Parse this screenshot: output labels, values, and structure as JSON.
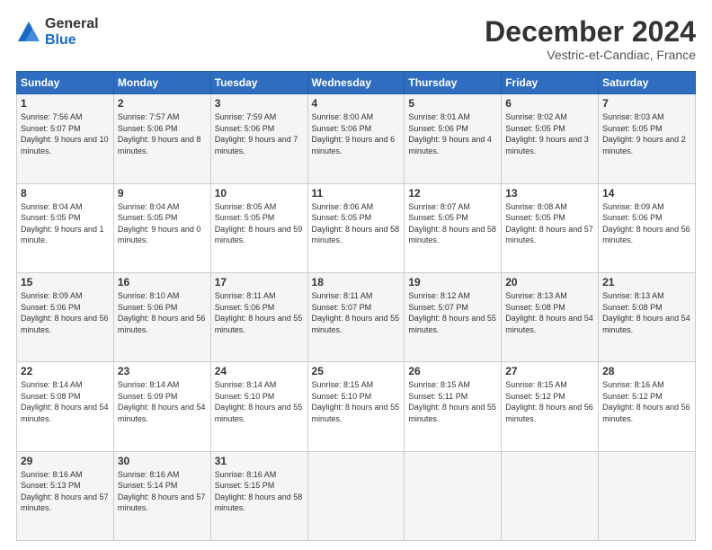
{
  "header": {
    "logo_line1": "General",
    "logo_line2": "Blue",
    "month": "December 2024",
    "location": "Vestric-et-Candiac, France"
  },
  "weekdays": [
    "Sunday",
    "Monday",
    "Tuesday",
    "Wednesday",
    "Thursday",
    "Friday",
    "Saturday"
  ],
  "weeks": [
    [
      {
        "day": "1",
        "rise": "Sunrise: 7:56 AM",
        "set": "Sunset: 5:07 PM",
        "light": "Daylight: 9 hours and 10 minutes."
      },
      {
        "day": "2",
        "rise": "Sunrise: 7:57 AM",
        "set": "Sunset: 5:06 PM",
        "light": "Daylight: 9 hours and 8 minutes."
      },
      {
        "day": "3",
        "rise": "Sunrise: 7:59 AM",
        "set": "Sunset: 5:06 PM",
        "light": "Daylight: 9 hours and 7 minutes."
      },
      {
        "day": "4",
        "rise": "Sunrise: 8:00 AM",
        "set": "Sunset: 5:06 PM",
        "light": "Daylight: 9 hours and 6 minutes."
      },
      {
        "day": "5",
        "rise": "Sunrise: 8:01 AM",
        "set": "Sunset: 5:06 PM",
        "light": "Daylight: 9 hours and 4 minutes."
      },
      {
        "day": "6",
        "rise": "Sunrise: 8:02 AM",
        "set": "Sunset: 5:05 PM",
        "light": "Daylight: 9 hours and 3 minutes."
      },
      {
        "day": "7",
        "rise": "Sunrise: 8:03 AM",
        "set": "Sunset: 5:05 PM",
        "light": "Daylight: 9 hours and 2 minutes."
      }
    ],
    [
      {
        "day": "8",
        "rise": "Sunrise: 8:04 AM",
        "set": "Sunset: 5:05 PM",
        "light": "Daylight: 9 hours and 1 minute."
      },
      {
        "day": "9",
        "rise": "Sunrise: 8:04 AM",
        "set": "Sunset: 5:05 PM",
        "light": "Daylight: 9 hours and 0 minutes."
      },
      {
        "day": "10",
        "rise": "Sunrise: 8:05 AM",
        "set": "Sunset: 5:05 PM",
        "light": "Daylight: 8 hours and 59 minutes."
      },
      {
        "day": "11",
        "rise": "Sunrise: 8:06 AM",
        "set": "Sunset: 5:05 PM",
        "light": "Daylight: 8 hours and 58 minutes."
      },
      {
        "day": "12",
        "rise": "Sunrise: 8:07 AM",
        "set": "Sunset: 5:05 PM",
        "light": "Daylight: 8 hours and 58 minutes."
      },
      {
        "day": "13",
        "rise": "Sunrise: 8:08 AM",
        "set": "Sunset: 5:05 PM",
        "light": "Daylight: 8 hours and 57 minutes."
      },
      {
        "day": "14",
        "rise": "Sunrise: 8:09 AM",
        "set": "Sunset: 5:06 PM",
        "light": "Daylight: 8 hours and 56 minutes."
      }
    ],
    [
      {
        "day": "15",
        "rise": "Sunrise: 8:09 AM",
        "set": "Sunset: 5:06 PM",
        "light": "Daylight: 8 hours and 56 minutes."
      },
      {
        "day": "16",
        "rise": "Sunrise: 8:10 AM",
        "set": "Sunset: 5:06 PM",
        "light": "Daylight: 8 hours and 56 minutes."
      },
      {
        "day": "17",
        "rise": "Sunrise: 8:11 AM",
        "set": "Sunset: 5:06 PM",
        "light": "Daylight: 8 hours and 55 minutes."
      },
      {
        "day": "18",
        "rise": "Sunrise: 8:11 AM",
        "set": "Sunset: 5:07 PM",
        "light": "Daylight: 8 hours and 55 minutes."
      },
      {
        "day": "19",
        "rise": "Sunrise: 8:12 AM",
        "set": "Sunset: 5:07 PM",
        "light": "Daylight: 8 hours and 55 minutes."
      },
      {
        "day": "20",
        "rise": "Sunrise: 8:13 AM",
        "set": "Sunset: 5:08 PM",
        "light": "Daylight: 8 hours and 54 minutes."
      },
      {
        "day": "21",
        "rise": "Sunrise: 8:13 AM",
        "set": "Sunset: 5:08 PM",
        "light": "Daylight: 8 hours and 54 minutes."
      }
    ],
    [
      {
        "day": "22",
        "rise": "Sunrise: 8:14 AM",
        "set": "Sunset: 5:08 PM",
        "light": "Daylight: 8 hours and 54 minutes."
      },
      {
        "day": "23",
        "rise": "Sunrise: 8:14 AM",
        "set": "Sunset: 5:09 PM",
        "light": "Daylight: 8 hours and 54 minutes."
      },
      {
        "day": "24",
        "rise": "Sunrise: 8:14 AM",
        "set": "Sunset: 5:10 PM",
        "light": "Daylight: 8 hours and 55 minutes."
      },
      {
        "day": "25",
        "rise": "Sunrise: 8:15 AM",
        "set": "Sunset: 5:10 PM",
        "light": "Daylight: 8 hours and 55 minutes."
      },
      {
        "day": "26",
        "rise": "Sunrise: 8:15 AM",
        "set": "Sunset: 5:11 PM",
        "light": "Daylight: 8 hours and 55 minutes."
      },
      {
        "day": "27",
        "rise": "Sunrise: 8:15 AM",
        "set": "Sunset: 5:12 PM",
        "light": "Daylight: 8 hours and 56 minutes."
      },
      {
        "day": "28",
        "rise": "Sunrise: 8:16 AM",
        "set": "Sunset: 5:12 PM",
        "light": "Daylight: 8 hours and 56 minutes."
      }
    ],
    [
      {
        "day": "29",
        "rise": "Sunrise: 8:16 AM",
        "set": "Sunset: 5:13 PM",
        "light": "Daylight: 8 hours and 57 minutes."
      },
      {
        "day": "30",
        "rise": "Sunrise: 8:16 AM",
        "set": "Sunset: 5:14 PM",
        "light": "Daylight: 8 hours and 57 minutes."
      },
      {
        "day": "31",
        "rise": "Sunrise: 8:16 AM",
        "set": "Sunset: 5:15 PM",
        "light": "Daylight: 8 hours and 58 minutes."
      },
      null,
      null,
      null,
      null
    ]
  ]
}
